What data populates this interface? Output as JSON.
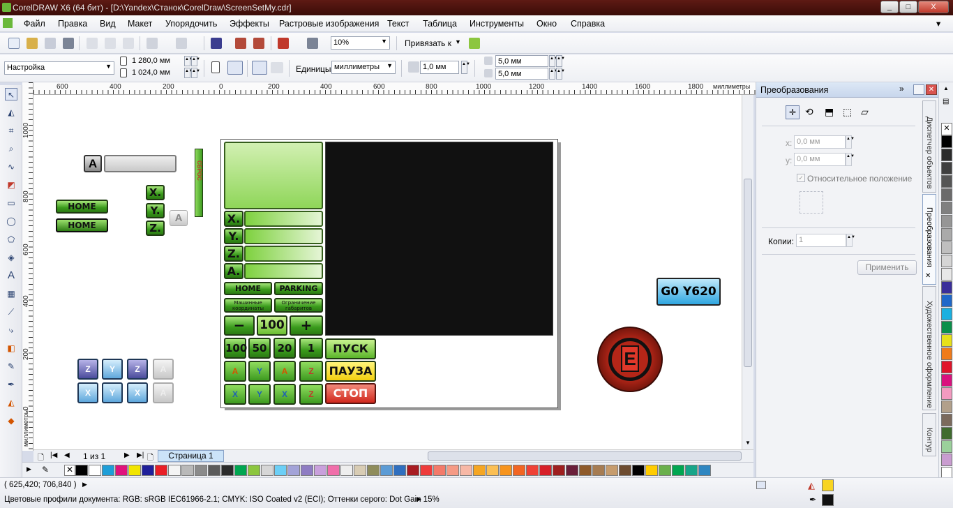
{
  "window": {
    "title": "CorelDRAW X6 (64 бит) - [D:\\Yandex\\Станок\\CorelDraw\\ScreenSetMy.cdr]",
    "min": "_",
    "max": "□",
    "close": "X"
  },
  "menu": [
    "Файл",
    "Правка",
    "Вид",
    "Макет",
    "Упорядочить",
    "Эффекты",
    "Растровые изображения",
    "Текст",
    "Таблица",
    "Инструменты",
    "Окно",
    "Справка"
  ],
  "toolbar": {
    "zoom": "10%",
    "snap_label": "Привязать к"
  },
  "propbar": {
    "preset": "Настройка",
    "width": "1 280,0 мм",
    "height": "1 024,0 мм",
    "units_label": "Единицы:",
    "units": "миллиметры",
    "nudge": "1,0 мм",
    "dup_x": "5,0 мм",
    "dup_y": "5,0 мм"
  },
  "ruler": {
    "h_ticks": [
      "600",
      "400",
      "200",
      "0",
      "200",
      "400",
      "600",
      "800",
      "1000",
      "1200",
      "1400",
      "1600",
      "1800"
    ],
    "h_unit": "миллиметры",
    "v_ticks": [
      "1000",
      "800",
      "600",
      "400",
      "200",
      "0"
    ],
    "v_unit": "миллиметры"
  },
  "design": {
    "axes": [
      "X.",
      "Y.",
      "Z.",
      "A."
    ],
    "home": "HOME",
    "parking": "PARKING",
    "mach_coords": "Машинные координаты",
    "limit": "Ограничение габаритов",
    "minus": "−",
    "step": "100",
    "plus": "+",
    "steps": [
      "100",
      "50",
      "20",
      "1"
    ],
    "start": "ПУСК",
    "pause": "ПАУЗА",
    "stop": "СТОП",
    "a_label": "A",
    "reset_vertical": "СБРОС",
    "gcode": "G0 Y620",
    "estop": "E",
    "small_axes": [
      "X.",
      "Y.",
      "Z."
    ],
    "arrow_letters_top": [
      "A",
      "Y",
      "A",
      "Z"
    ],
    "arrow_letters_bottom": [
      "X",
      "Y",
      "X",
      "Z"
    ],
    "blue_top": [
      "Z",
      "Y",
      "Z",
      "A"
    ],
    "blue_bottom": [
      "X",
      "Y",
      "X",
      "A"
    ]
  },
  "pages": {
    "counter": "1 из 1",
    "tab": "Страница 1"
  },
  "docker": {
    "title": "Преобразования",
    "x_label": "x:",
    "x_value": "0,0 мм",
    "y_label": "y:",
    "y_value": "0,0 мм",
    "relative": "Относительное положение",
    "copies_label": "Копии:",
    "copies": "1",
    "apply": "Применить",
    "tabs": [
      "Диспетчер объектов",
      "Преобразования",
      "Художественное оформление",
      "Контур"
    ]
  },
  "status": {
    "coords": "( 625,420; 706,840 )",
    "profiles": "Цветовые профили документа: RGB: sRGB IEC61966-2.1; CMYK: ISO Coated v2 (ECI); Оттенки серого: Dot Gain 15%"
  },
  "colors": {
    "palette": [
      "#000000",
      "#ffffff",
      "#1e9ed8",
      "#e0127c",
      "#f2e500",
      "#1f1f9a",
      "#e91e26",
      "#f4f4f4",
      "#b9b9b9",
      "#8b8b8b",
      "#5b5b5b",
      "#2b2b2b",
      "#00a651",
      "#8cc63f",
      "#d6d6d6",
      "#6ccff6",
      "#a3a3d8",
      "#8e7cc3",
      "#c9a0dc",
      "#f06eaa",
      "#eeeeee",
      "#d8ccb4",
      "#8e8c5c",
      "#5b9bd5",
      "#2f6fbf",
      "#a81c22",
      "#ee3b3b",
      "#f37a6a",
      "#f59a85",
      "#f7b8a6",
      "#f5a623",
      "#fbbf53",
      "#f7941d",
      "#f26522",
      "#ef4136",
      "#d71f28",
      "#9e1f1f",
      "#6a1f3a",
      "#8e5a2a",
      "#a67c52",
      "#c69c6d",
      "#6d4c30",
      "#000000",
      "#ffcc00",
      "#6ab04c",
      "#00a651",
      "#17a589",
      "#2e86c1"
    ],
    "right_palette": [
      "#000000",
      "#2b2b2b",
      "#3f3f3f",
      "#555555",
      "#6b6b6b",
      "#808080",
      "#969696",
      "#aaaaaa",
      "#bfbfbf",
      "#d5d5d5",
      "#e8e8e8",
      "#3a2e9a",
      "#1f68c9",
      "#1ab0e0",
      "#0a8f4a",
      "#e7e01a",
      "#f07b1b",
      "#e0142a",
      "#d9117e",
      "#f39ac0",
      "#b2a08b",
      "#7b6a5d",
      "#3f6b2f",
      "#9bd09b",
      "#c99cd0",
      "#ffffff"
    ],
    "fill_status": "#f8d420",
    "outline_status": "#111111"
  }
}
